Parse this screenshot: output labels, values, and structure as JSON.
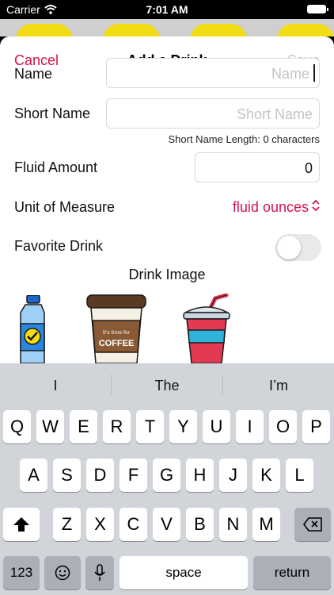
{
  "status_bar": {
    "carrier": "Carrier",
    "time": "7:01 AM"
  },
  "nav": {
    "cancel": "Cancel",
    "title": "Add a Drink",
    "save": "Save"
  },
  "form": {
    "name_label": "Name",
    "name_placeholder": "Name",
    "short_name_label": "Short Name",
    "short_name_placeholder": "Short Name",
    "short_name_hint": "Short Name Length: 0 characters",
    "fluid_amount_label": "Fluid Amount",
    "fluid_amount_value": "0",
    "unit_label": "Unit of Measure",
    "unit_value": "fluid ounces",
    "favorite_label": "Favorite Drink",
    "favorite_on": false,
    "drink_image_label": "Drink Image"
  },
  "drink_images": [
    {
      "name": "water-bottle-icon",
      "selected": true
    },
    {
      "name": "coffee-cup-icon",
      "text_small": "it's time for",
      "text": "COFFEE"
    },
    {
      "name": "soda-cup-icon"
    }
  ],
  "keyboard": {
    "suggestions": [
      "I",
      "The",
      "I’m"
    ],
    "row1": [
      "Q",
      "W",
      "E",
      "R",
      "T",
      "Y",
      "U",
      "I",
      "O",
      "P"
    ],
    "row2": [
      "A",
      "S",
      "D",
      "F",
      "G",
      "H",
      "J",
      "K",
      "L"
    ],
    "row3": [
      "Z",
      "X",
      "C",
      "V",
      "B",
      "N",
      "M"
    ],
    "numbers_key": "123",
    "space_key": "space",
    "return_key": "return"
  },
  "colors": {
    "accent": "#d4124a",
    "keyboard_bg": "#d1d4d9",
    "key_bg": "#ffffff",
    "key_dark_bg": "#abafb7"
  }
}
